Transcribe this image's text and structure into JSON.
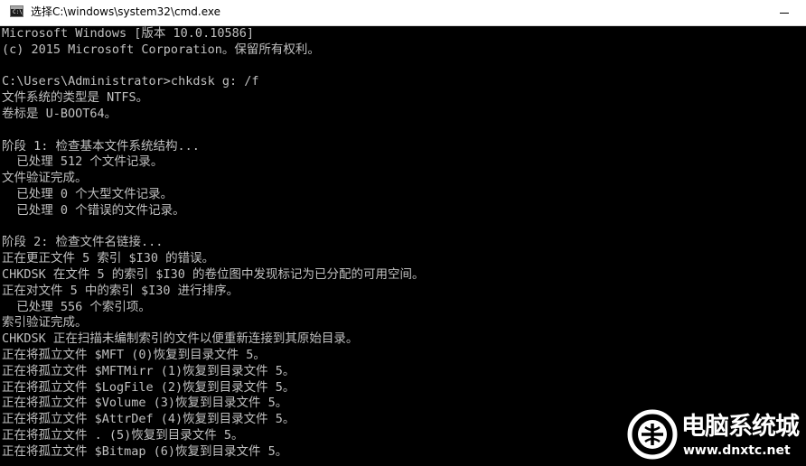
{
  "window": {
    "title": "选择C:\\windows\\system32\\cmd.exe",
    "icon": "cmd-app-icon",
    "icon_glyph": "C:\\"
  },
  "console": {
    "lines": [
      "Microsoft Windows [版本 10.0.10586]",
      "(c) 2015 Microsoft Corporation。保留所有权利。",
      "",
      "C:\\Users\\Administrator>chkdsk g: /f",
      "文件系统的类型是 NTFS。",
      "卷标是 U-BOOT64。",
      "",
      "阶段 1: 检查基本文件系统结构...",
      "  已处理 512 个文件记录。",
      "文件验证完成。",
      "  已处理 0 个大型文件记录。",
      "  已处理 0 个错误的文件记录。",
      "",
      "阶段 2: 检查文件名链接...",
      "正在更正文件 5 索引 $I30 的错误。",
      "CHKDSK 在文件 5 的索引 $I30 的卷位图中发现标记为已分配的可用空间。",
      "正在对文件 5 中的索引 $I30 进行排序。",
      "  已处理 556 个索引项。",
      "索引验证完成。",
      "CHKDSK 正在扫描未编制索引的文件以便重新连接到其原始目录。",
      "正在将孤立文件 $MFT (0)恢复到目录文件 5。",
      "正在将孤立文件 $MFTMirr (1)恢复到目录文件 5。",
      "正在将孤立文件 $LogFile (2)恢复到目录文件 5。",
      "正在将孤立文件 $Volume (3)恢复到目录文件 5。",
      "正在将孤立文件 $AttrDef (4)恢复到目录文件 5。",
      "正在将孤立文件 . (5)恢复到目录文件 5。",
      "正在将孤立文件 $Bitmap (6)恢复到目录文件 5。"
    ]
  },
  "watermark": {
    "name": "电脑系统城",
    "url": "www.dnxtc.net"
  },
  "colors": {
    "console_background": "#000000",
    "console_text": "#c0c0c0",
    "titlebar_background": "#ffffff",
    "watermark_text": "#ffffff"
  }
}
